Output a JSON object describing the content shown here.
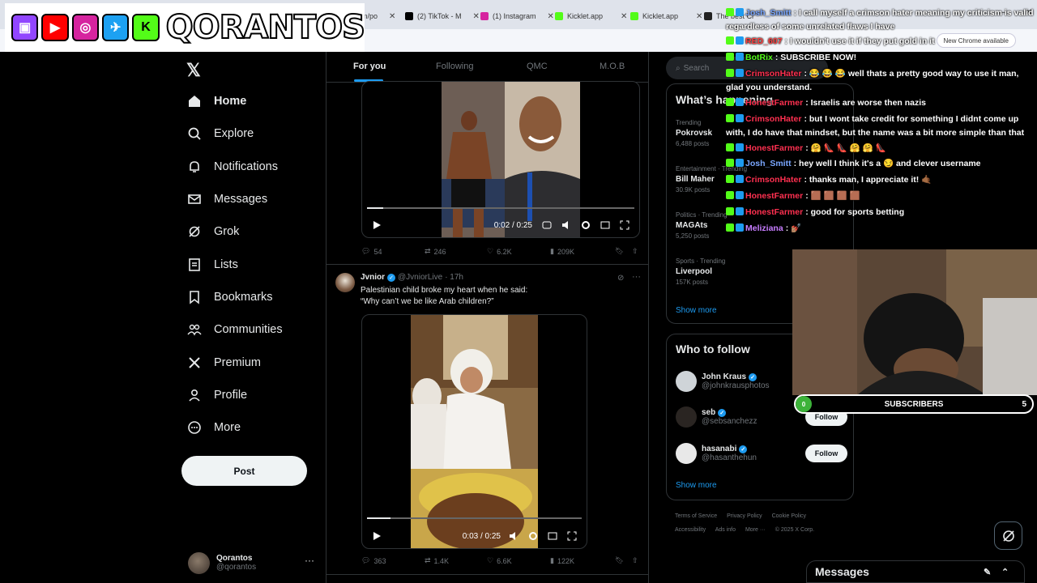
{
  "browser": {
    "tabs": [
      {
        "label": "(2) TikTok - M",
        "color": "#000000"
      },
      {
        "label": "(1) Instagram",
        "color": "#d6249f"
      },
      {
        "label": "Kicklet.app",
        "color": "#53fc18"
      },
      {
        "label": "Kicklet.app",
        "color": "#53fc18"
      },
      {
        "label": "The best Cr",
        "color": "#222222"
      }
    ],
    "partial_tab": "m/po",
    "new_chrome": "New Chrome available"
  },
  "banner": {
    "name": "QORANTOS",
    "icons": [
      "twitch-icon",
      "youtube-icon",
      "instagram-icon",
      "twitter-bird-icon",
      "kick-icon"
    ],
    "colors": {
      "twitch": "#9146ff",
      "youtube": "#ff0000",
      "instagram": "#d6249f",
      "twitter": "#1da1f2",
      "kick": "#53fc18"
    }
  },
  "nav": {
    "items": [
      {
        "label": "Home",
        "icon": "home-icon",
        "active": true
      },
      {
        "label": "Explore",
        "icon": "search-icon"
      },
      {
        "label": "Notifications",
        "icon": "bell-icon"
      },
      {
        "label": "Messages",
        "icon": "envelope-icon"
      },
      {
        "label": "Grok",
        "icon": "grok-icon"
      },
      {
        "label": "Lists",
        "icon": "list-icon"
      },
      {
        "label": "Bookmarks",
        "icon": "bookmark-icon"
      },
      {
        "label": "Communities",
        "icon": "communities-icon"
      },
      {
        "label": "Premium",
        "icon": "x-icon"
      },
      {
        "label": "Profile",
        "icon": "person-icon"
      },
      {
        "label": "More",
        "icon": "more-circle-icon"
      }
    ],
    "post": "Post"
  },
  "account": {
    "name": "Qorantos",
    "handle": "@qorantos",
    "menu": "···"
  },
  "feed": {
    "tabs": [
      "For you",
      "Following",
      "QMC",
      "M.O.B"
    ],
    "post1": {
      "time": "0:02 / 0:25",
      "progress": 0.06,
      "replies": "54",
      "reposts": "246",
      "likes": "6.2K",
      "views": "209K"
    },
    "post2": {
      "name": "Jvnior",
      "handle": "@JvniorLive",
      "time": "· 17h",
      "text1": "Palestinian child broke my heart when he said:",
      "text2": "“Why can’t we be like Arab children?”",
      "video_time": "0:03 / 0:25",
      "progress": 0.11,
      "replies": "363",
      "reposts": "1.4K",
      "likes": "6.6K",
      "views": "122K"
    }
  },
  "right": {
    "search_placeholder": "Search",
    "happening_title": "What’s happening",
    "trends": [
      {
        "context": "Trending",
        "title": "Pokrovsk",
        "count": "6,488 posts"
      },
      {
        "context": "Entertainment · Trending",
        "title": "Bill Maher",
        "count": "30.9K posts"
      },
      {
        "context": "Politics · Trending",
        "title": "MAGAts",
        "count": "5,250 posts"
      },
      {
        "context": "Sports · Trending",
        "title": "Liverpool",
        "count": "157K posts"
      }
    ],
    "show_more": "Show more",
    "wtf_title": "Who to follow",
    "follows": [
      {
        "name": "John Kraus",
        "handle": "@johnkrausphotos"
      },
      {
        "name": "seb",
        "handle": "@sebsanchezz"
      },
      {
        "name": "hasanabi",
        "handle": "@hasanthehun"
      }
    ],
    "follow_label": "Follow",
    "footer1": [
      "Terms of Service",
      "Privacy Policy",
      "Cookie Policy"
    ],
    "footer2": [
      "Accessibility",
      "Ads info",
      "More ···",
      "© 2025 X Corp."
    ]
  },
  "chat": [
    {
      "user": "Josh_Smitt",
      "text": "I call myself a crimson hater meaning my criticism is valid regardless of some unrelated flaws I have",
      "color": "#7aa7ff"
    },
    {
      "user": "RED_607",
      "text": "I wouldn't use it if they put gold in it",
      "color": "#ff4040"
    },
    {
      "user": "BotRix",
      "text": "SUBSCRIBE NOW!",
      "color": "#53fc18"
    },
    {
      "user": "CrimsonHater",
      "text": "😂 😂 😂 well thats a pretty good way to use it man, glad you understand.",
      "color": "#ff3050"
    },
    {
      "user": "HonestFarmer",
      "text": "Israelis are worse then nazis",
      "color": "#ff3050"
    },
    {
      "user": "CrimsonHater",
      "text": "but I wont take credit for something I didnt come up with, I do have that mindset, but the name was a bit more simple than that",
      "color": "#ff3050"
    },
    {
      "user": "HonestFarmer",
      "text": "🤗 👠 👠 🤗 🤗 👠",
      "color": "#ff3050"
    },
    {
      "user": "Josh_Smitt",
      "text": "hey well I think it's a 😏 and clever username",
      "color": "#7aa7ff"
    },
    {
      "user": "CrimsonHater",
      "text": "thanks man, I appreciate it! 🤙🏾",
      "color": "#ff3050"
    },
    {
      "user": "HonestFarmer",
      "text": "🟫 🟫 🟫 🟫",
      "color": "#ff3050"
    },
    {
      "user": "HonestFarmer",
      "text": "good for sports betting",
      "color": "#ff3050"
    },
    {
      "user": "Meliziana",
      "text": "💅🏽",
      "color": "#c77dff"
    }
  ],
  "subs": {
    "label": "SUBSCRIBERS",
    "current": "0",
    "goal": "5",
    "progress": 0.0
  },
  "drawer": {
    "title": "Messages"
  }
}
